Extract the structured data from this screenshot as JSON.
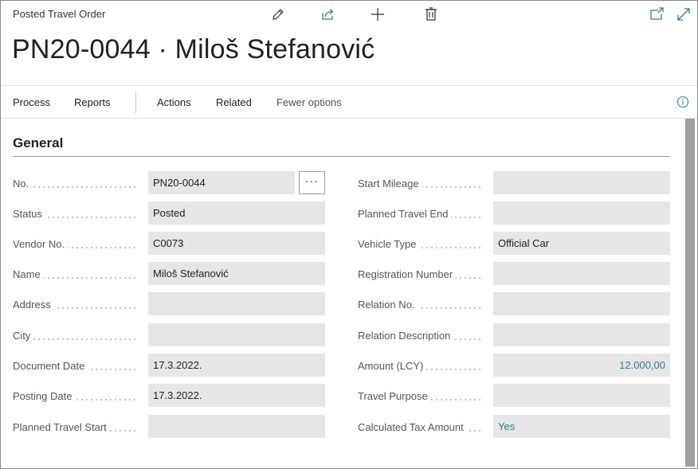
{
  "header": {
    "caption": "Posted Travel Order",
    "record_title": "PN20-0044 · Miloš Stefanović",
    "icons": [
      "edit-icon",
      "share-icon",
      "new-icon",
      "delete-icon",
      "open-in-new-window-icon",
      "expand-icon"
    ]
  },
  "actions": {
    "process": "Process",
    "reports": "Reports",
    "actions": "Actions",
    "related": "Related",
    "fewer_options": "Fewer options"
  },
  "section": {
    "title": "General"
  },
  "left_fields": [
    {
      "label": "No.",
      "value": "PN20-0044"
    },
    {
      "label": "Status",
      "value": "Posted"
    },
    {
      "label": "Vendor No.",
      "value": "C0073"
    },
    {
      "label": "Name",
      "value": "Miloš Stefanović"
    },
    {
      "label": "Address",
      "value": ""
    },
    {
      "label": "City",
      "value": ""
    },
    {
      "label": "Document Date",
      "value": "17.3.2022."
    },
    {
      "label": "Posting Date",
      "value": "17.3.2022."
    },
    {
      "label": "Planned Travel Start",
      "value": ""
    }
  ],
  "right_fields": [
    {
      "label": "Start Mileage",
      "value": ""
    },
    {
      "label": "Planned Travel End",
      "value": ""
    },
    {
      "label": "Vehicle Type",
      "value": "Official Car"
    },
    {
      "label": "Registration Number",
      "value": ""
    },
    {
      "label": "Relation No.",
      "value": ""
    },
    {
      "label": "Relation Description",
      "value": ""
    },
    {
      "label": "Amount (LCY)",
      "value": "12.000,00"
    },
    {
      "label": "Travel Purpose",
      "value": ""
    },
    {
      "label": "Calculated Tax Amount",
      "value": "Yes"
    }
  ],
  "lookup_button": "···",
  "colors": {
    "accent": "#2a7f9e",
    "field_bg": "#e6e6e6",
    "scrollbar": "#a0a0a0"
  }
}
